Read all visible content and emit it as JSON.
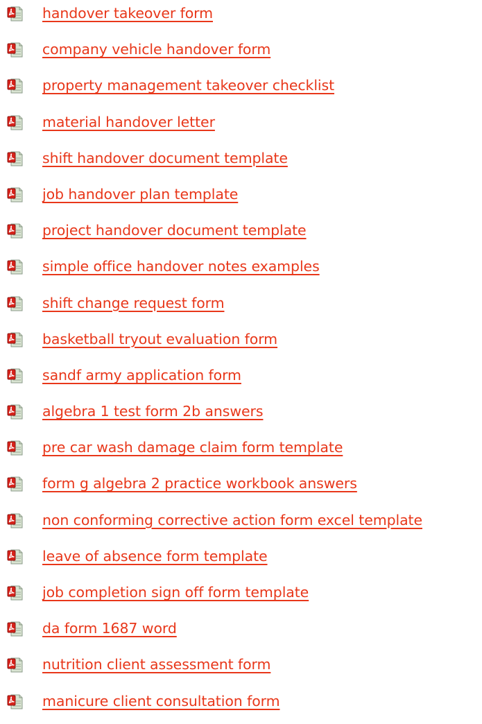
{
  "colors": {
    "link": "#e8371a",
    "icon_red": "#d8221a",
    "icon_paper": "#d9e4d2"
  },
  "icon": "pdf-document-icon",
  "documents": [
    "handover takeover form",
    "company vehicle handover form",
    "property management takeover checklist",
    "material handover letter",
    "shift handover document template",
    "job handover plan template",
    "project handover document template",
    "simple office handover notes examples",
    "shift change request form",
    "basketball tryout evaluation form",
    "sandf army application form",
    "algebra 1 test form 2b answers",
    "pre car wash damage claim form template",
    "form g algebra 2 practice workbook answers",
    "non conforming corrective action form excel template",
    "leave of absence form template",
    "job completion sign off form template",
    "da form 1687 word",
    "nutrition client assessment form",
    "manicure client consultation form"
  ]
}
